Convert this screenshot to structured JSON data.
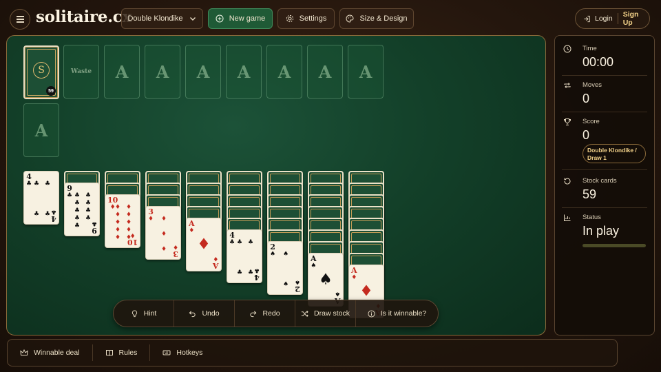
{
  "header": {
    "logo": "solitaire.cx",
    "game_select": "Double Klondike",
    "new_game": "New game",
    "settings": "Settings",
    "size_design": "Size & Design",
    "login": "Login",
    "signup": "Sign Up"
  },
  "board": {
    "waste_label": "Waste",
    "foundation_label": "A",
    "stock_count": "59",
    "stock_logo": "S"
  },
  "tableau": [
    {
      "backs": 0,
      "rank": "4",
      "suit": "♣",
      "color": "black"
    },
    {
      "backs": 1,
      "rank": "9",
      "suit": "♣",
      "color": "black"
    },
    {
      "backs": 2,
      "rank": "10",
      "suit": "♦",
      "color": "red"
    },
    {
      "backs": 3,
      "rank": "3",
      "suit": "♦",
      "color": "red"
    },
    {
      "backs": 4,
      "rank": "A",
      "suit": "♦",
      "color": "red"
    },
    {
      "backs": 5,
      "rank": "4",
      "suit": "♣",
      "color": "black"
    },
    {
      "backs": 6,
      "rank": "2",
      "suit": "♠",
      "color": "black"
    },
    {
      "backs": 7,
      "rank": "A",
      "suit": "♠",
      "color": "black"
    },
    {
      "backs": 8,
      "rank": "A",
      "suit": "♦",
      "color": "red"
    }
  ],
  "actions": {
    "hint": "Hint",
    "undo": "Undo",
    "redo": "Redo",
    "draw_stock": "Draw stock",
    "winnable": "Is it winnable?"
  },
  "sidebar": {
    "time_label": "Time",
    "time_value": "00:00",
    "moves_label": "Moves",
    "moves_value": "0",
    "score_label": "Score",
    "score_value": "0",
    "mode_pill": "Double Klondike / Draw 1",
    "stock_label": "Stock cards",
    "stock_value": "59",
    "status_label": "Status",
    "status_value": "In play",
    "status_progress": 0
  },
  "footer": {
    "winnable_deal": "Winnable deal",
    "rules": "Rules",
    "hotkeys": "Hotkeys"
  },
  "colors": {
    "felt": "#134029",
    "accent_green": "#1f5a36",
    "gold": "#f4d38a",
    "red_suit": "#c42a1e"
  },
  "icons": [
    "menu-icon",
    "chevron-down-icon",
    "plus-circle-icon",
    "gear-icon",
    "palette-icon",
    "login-icon",
    "bulb-icon",
    "undo-icon",
    "redo-icon",
    "shuffle-icon",
    "info-icon",
    "clock-icon",
    "repeat-icon",
    "trophy-icon",
    "refresh-icon",
    "chart-icon",
    "crown-icon",
    "book-icon",
    "keyboard-icon"
  ]
}
